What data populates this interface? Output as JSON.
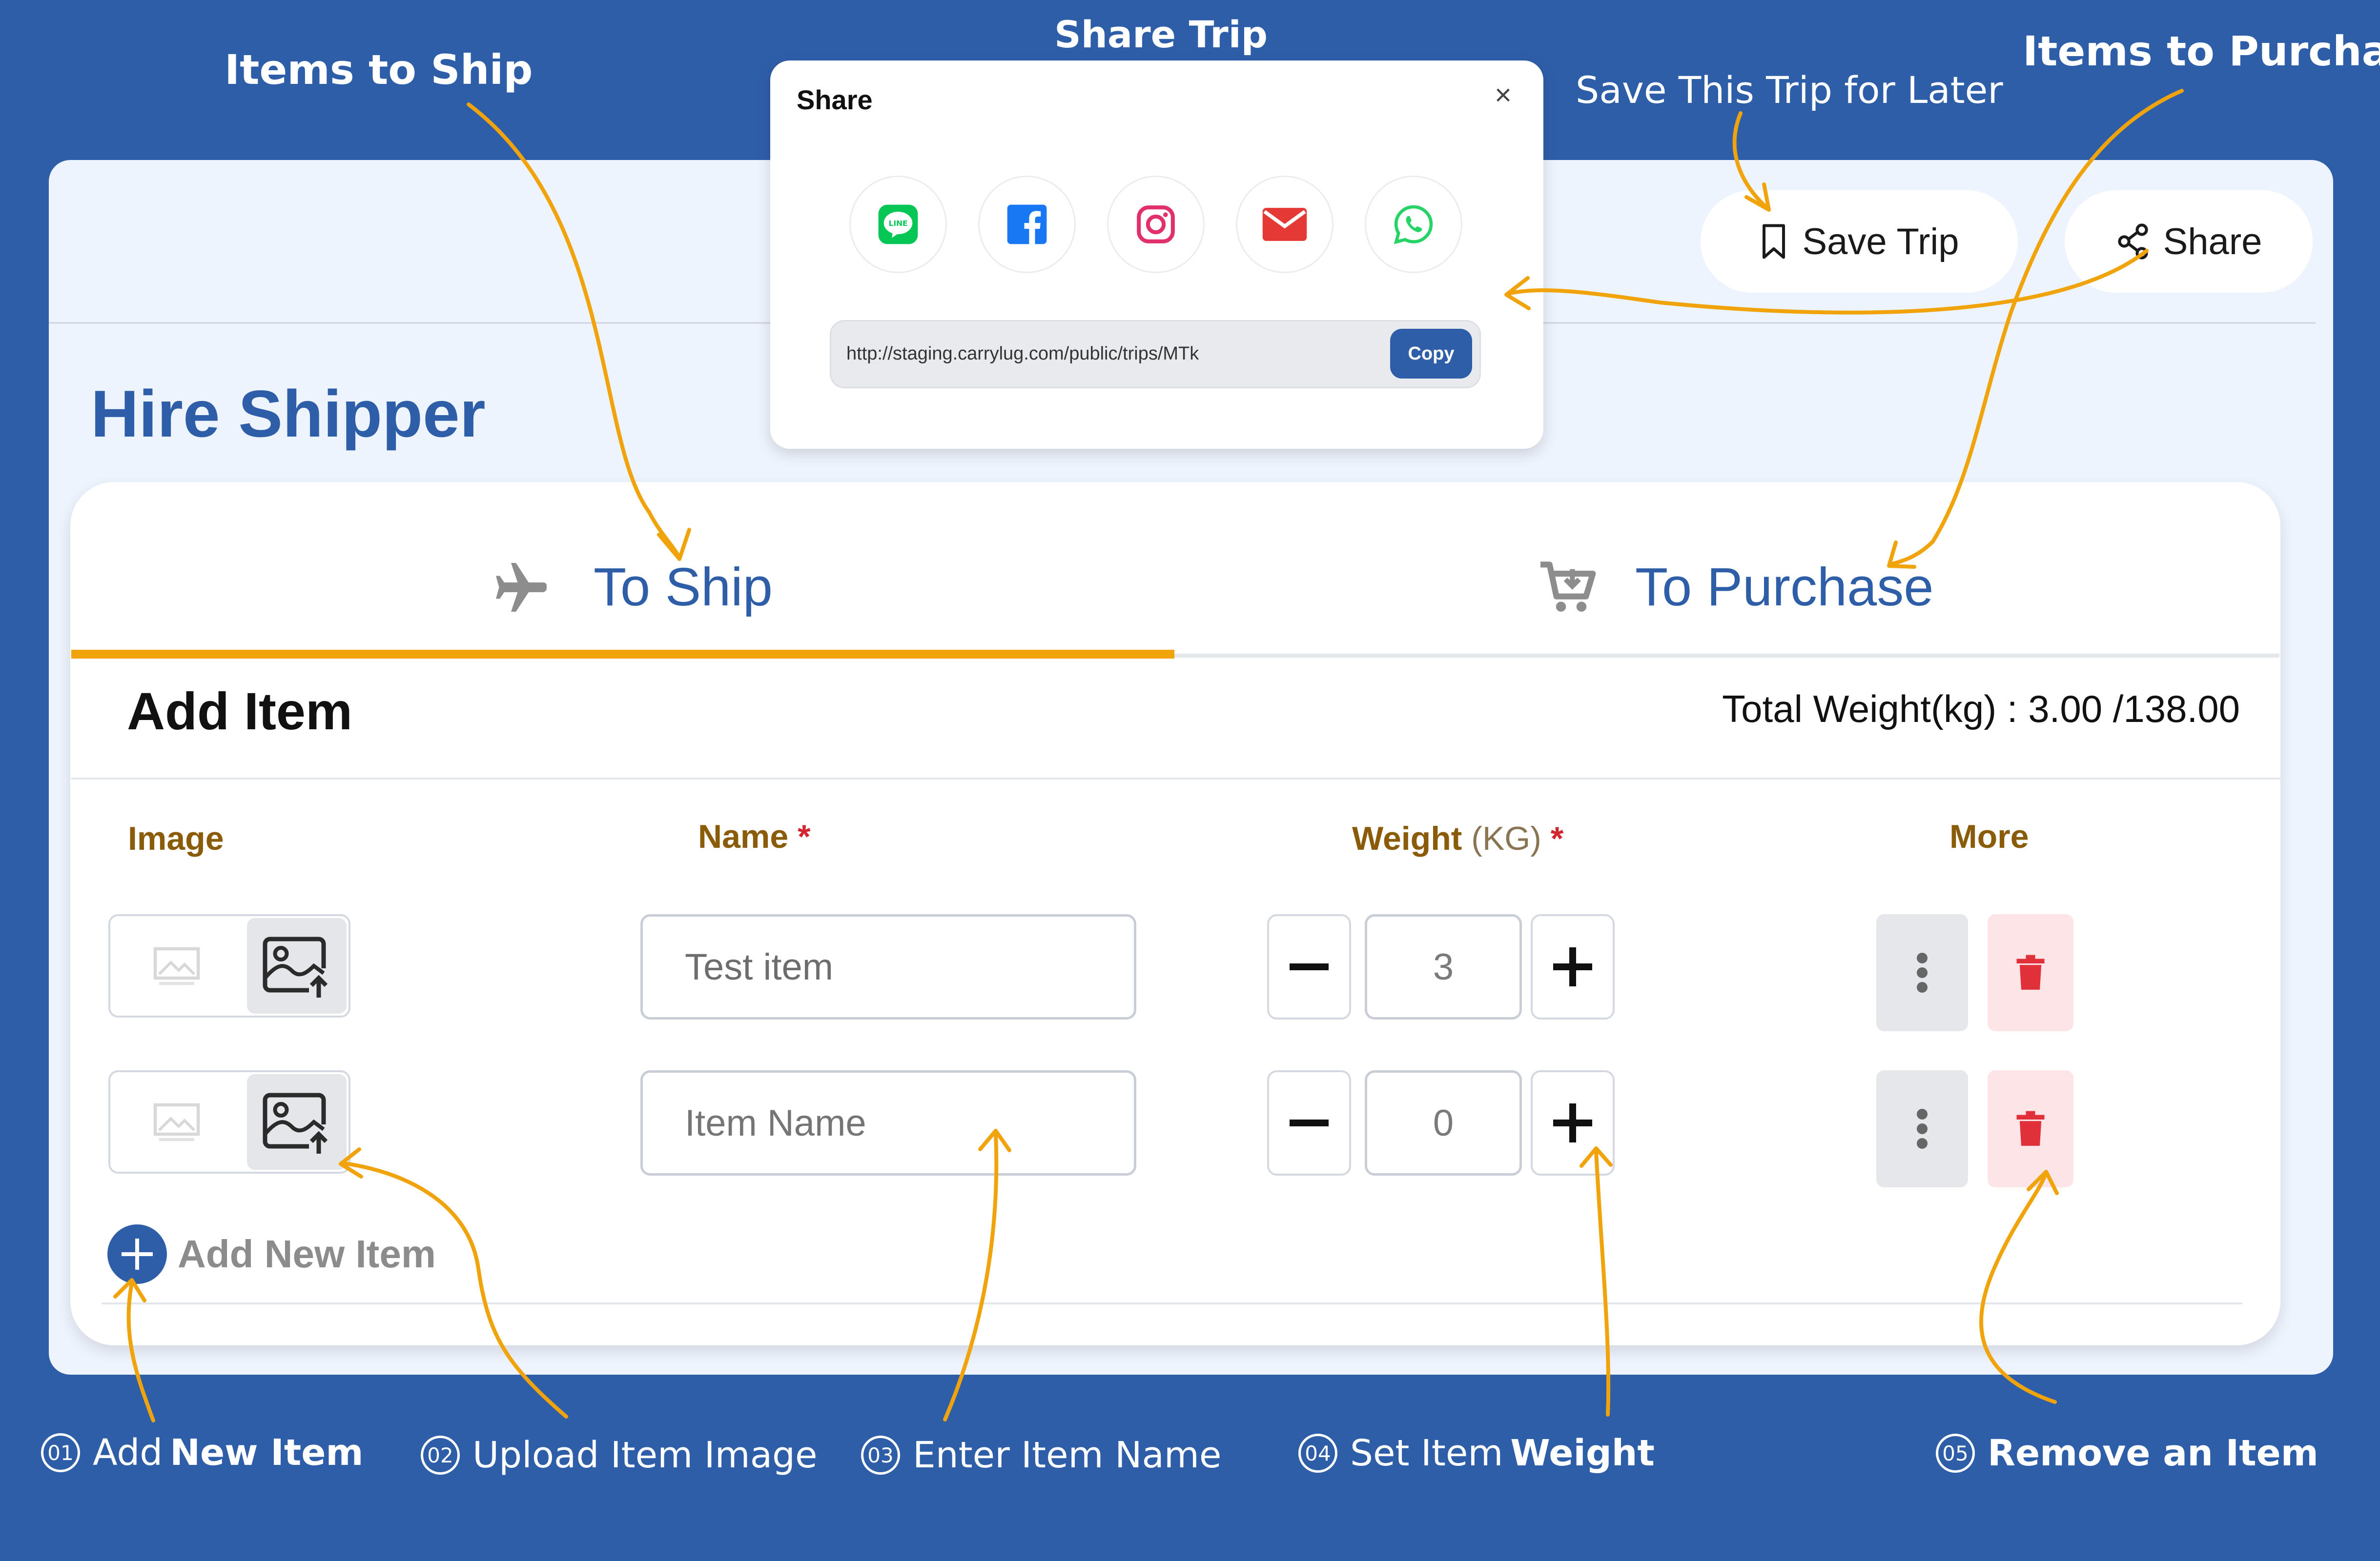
{
  "annotations": {
    "items_to_ship": "Items to Ship",
    "share_trip": "Share Trip",
    "save_for_later": "Save This Trip for Later",
    "items_to_purchase": "Items to Purchase"
  },
  "callouts": [
    {
      "num": "01",
      "text_plain": "Add ",
      "text_bold": "New Item"
    },
    {
      "num": "02",
      "text_plain": "Upload Item Image",
      "text_bold": ""
    },
    {
      "num": "03",
      "text_plain": "Enter Item Name",
      "text_bold": ""
    },
    {
      "num": "04",
      "text_plain": "Set Item ",
      "text_bold": "Weight"
    },
    {
      "num": "05",
      "text_plain": "",
      "text_bold": "Remove an Item"
    }
  ],
  "header": {
    "save_trip_label": "Save Trip",
    "share_label": "Share"
  },
  "page_title": "Hire Shipper",
  "tabs": [
    {
      "label": "To Ship",
      "active": true
    },
    {
      "label": "To Purchase",
      "active": false
    }
  ],
  "add_item": {
    "title": "Add Item",
    "total_weight": "Total Weight(kg) : 3.00 /138.00"
  },
  "columns": {
    "image": "Image",
    "name": "Name",
    "weight": "Weight",
    "weight_unit": "(KG)",
    "required_mark": "*",
    "more": "More"
  },
  "items": [
    {
      "name_value": "Test item",
      "name_placeholder": "Item Name",
      "weight": "3"
    },
    {
      "name_value": "",
      "name_placeholder": "Item Name",
      "weight": "0"
    }
  ],
  "add_new_label": "Add New Item",
  "share_modal": {
    "title": "Share",
    "close": "×",
    "url": "http://staging.carrylug.com/public/trips/MTk",
    "copy_label": "Copy",
    "socials": [
      "line",
      "facebook",
      "instagram",
      "email",
      "whatsapp"
    ]
  },
  "colors": {
    "brand_blue": "#2f5ea9",
    "accent_orange": "#f0a30a",
    "danger_red": "#e0303a"
  }
}
